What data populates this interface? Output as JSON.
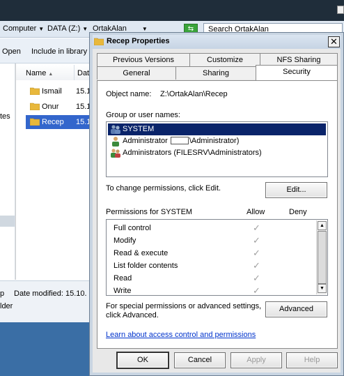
{
  "explorer": {
    "breadcrumb": [
      "Computer",
      "DATA (Z:)",
      "OrtakAlan"
    ],
    "search_placeholder": "Search OrtakAlan",
    "commands": [
      "Open",
      "Include in library"
    ],
    "nav_partial_text": "tes",
    "columns": {
      "name": "Name",
      "date": "Date"
    },
    "files": [
      {
        "name": "Ismail",
        "date": "15.1",
        "selected": false
      },
      {
        "name": "Onur",
        "date": "15.1",
        "selected": false
      },
      {
        "name": "Recep",
        "date": "15.1",
        "selected": true
      }
    ],
    "details": {
      "prefix": "p",
      "date_modified": "Date modified: 15.10.",
      "type_partial": "lder"
    }
  },
  "dialog": {
    "title": "Recep Properties",
    "tabs_row1": [
      "Previous Versions",
      "Customize",
      "NFS Sharing"
    ],
    "tabs_row2": [
      "General",
      "Sharing",
      "Security"
    ],
    "active_tab": "Security",
    "object_name_label": "Object name:",
    "object_name_value": "Z:\\OrtakAlan\\Recep",
    "group_label": "Group or user names:",
    "groups": [
      {
        "name": "SYSTEM",
        "icon": "group-icon",
        "selected": true
      },
      {
        "name_prefix": "Administrator",
        "name_suffix": "\\Administrator)",
        "icon": "user-icon",
        "selected": false
      },
      {
        "name": "Administrators (FILESRV\\Administrators)",
        "icon": "group-icon",
        "selected": false
      }
    ],
    "change_perm_text": "To change permissions, click Edit.",
    "edit_button": "Edit...",
    "perm_header": "Permissions for SYSTEM",
    "allow_header": "Allow",
    "deny_header": "Deny",
    "permissions": [
      {
        "name": "Full control",
        "allow": "✓",
        "deny": ""
      },
      {
        "name": "Modify",
        "allow": "✓",
        "deny": ""
      },
      {
        "name": "Read & execute",
        "allow": "✓",
        "deny": ""
      },
      {
        "name": "List folder contents",
        "allow": "✓",
        "deny": ""
      },
      {
        "name": "Read",
        "allow": "✓",
        "deny": ""
      },
      {
        "name": "Write",
        "allow": "✓",
        "deny": ""
      }
    ],
    "special_text_1": "For special permissions or advanced settings,",
    "special_text_2": "click Advanced.",
    "advanced_button": "Advanced",
    "learn_link": "Learn about access control and permissions",
    "buttons": {
      "ok": "OK",
      "cancel": "Cancel",
      "apply": "Apply",
      "help": "Help"
    },
    "close_glyph": "✕"
  }
}
